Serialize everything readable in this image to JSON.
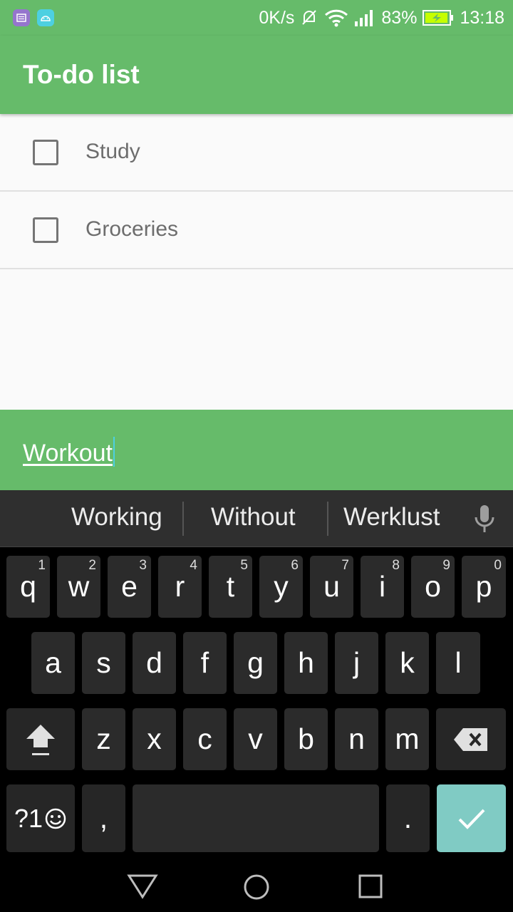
{
  "status_bar": {
    "net_speed": "0K/s",
    "battery_percent": "83%",
    "time": "13:18"
  },
  "app_bar": {
    "title": "To-do list"
  },
  "todos": [
    {
      "label": "Study",
      "checked": false
    },
    {
      "label": "Groceries",
      "checked": false
    }
  ],
  "input": {
    "value": "Workout"
  },
  "keyboard": {
    "suggestions": [
      "Working",
      "Without",
      "Werklust"
    ],
    "row1": [
      "q",
      "w",
      "e",
      "r",
      "t",
      "y",
      "u",
      "i",
      "o",
      "p"
    ],
    "row1_hints": [
      "1",
      "2",
      "3",
      "4",
      "5",
      "6",
      "7",
      "8",
      "9",
      "0"
    ],
    "row2": [
      "a",
      "s",
      "d",
      "f",
      "g",
      "h",
      "j",
      "k",
      "l"
    ],
    "row3": [
      "z",
      "x",
      "c",
      "v",
      "b",
      "n",
      "m"
    ],
    "symbols_label": "?1",
    "comma": ",",
    "period": "."
  },
  "colors": {
    "primary": "#66bb6a",
    "accent": "#80cbc4",
    "cursor": "#4dd0e1"
  }
}
